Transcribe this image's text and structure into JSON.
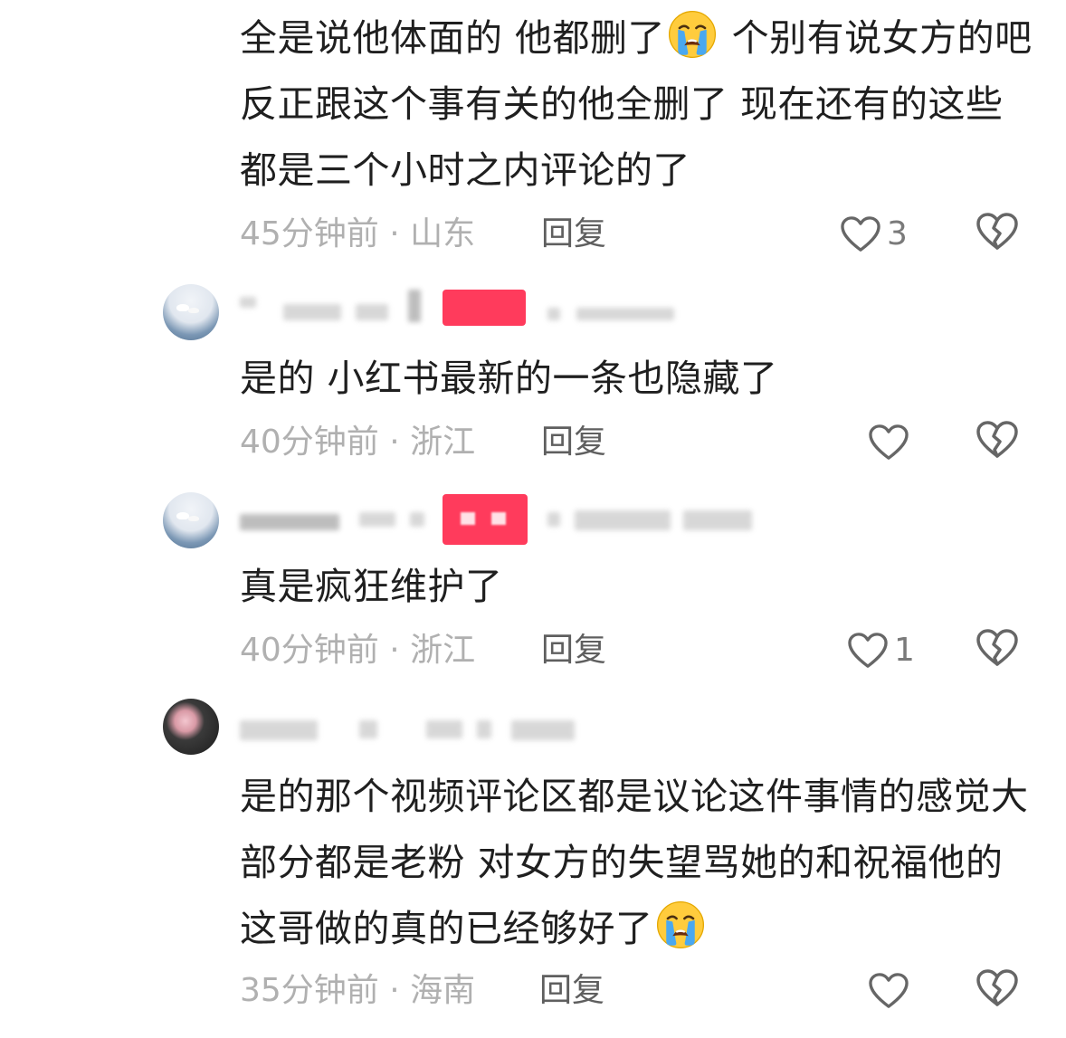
{
  "comments": [
    {
      "text_parts": [
        "全是说他体面的 他都删了",
        "个别有说女方的吧 反正跟这个事有关的他全删了 现在还有的这些都是三个小时之内评论的了"
      ],
      "time": "45分钟前",
      "location": "山东",
      "reply_label": "回复",
      "like_count": "3"
    },
    {
      "text": "是的 小红书最新的一条也隐藏了",
      "time": "40分钟前",
      "location": "浙江",
      "reply_label": "回复",
      "like_count": ""
    },
    {
      "text": "真是疯狂维护了",
      "time": "40分钟前",
      "location": "浙江",
      "reply_label": "回复",
      "like_count": "1"
    },
    {
      "text_parts": [
        "是的那个视频评论区都是议论这件事情的感觉大部分都是老粉 对女方的失望骂她的和祝福他的 这哥做的真的已经够好了",
        ""
      ],
      "time": "35分钟前",
      "location": "海南",
      "reply_label": "回复",
      "like_count": ""
    }
  ],
  "separator": " · ",
  "icons": {
    "emoji": "loudly-crying-face",
    "like": "heart-outline",
    "dislike": "broken-heart-outline"
  },
  "colors": {
    "text": "#1f1f1f",
    "meta": "#b0b0b0",
    "reply": "#5f5f5f",
    "icon": "#666666",
    "redacted": "#ff3b5c"
  }
}
